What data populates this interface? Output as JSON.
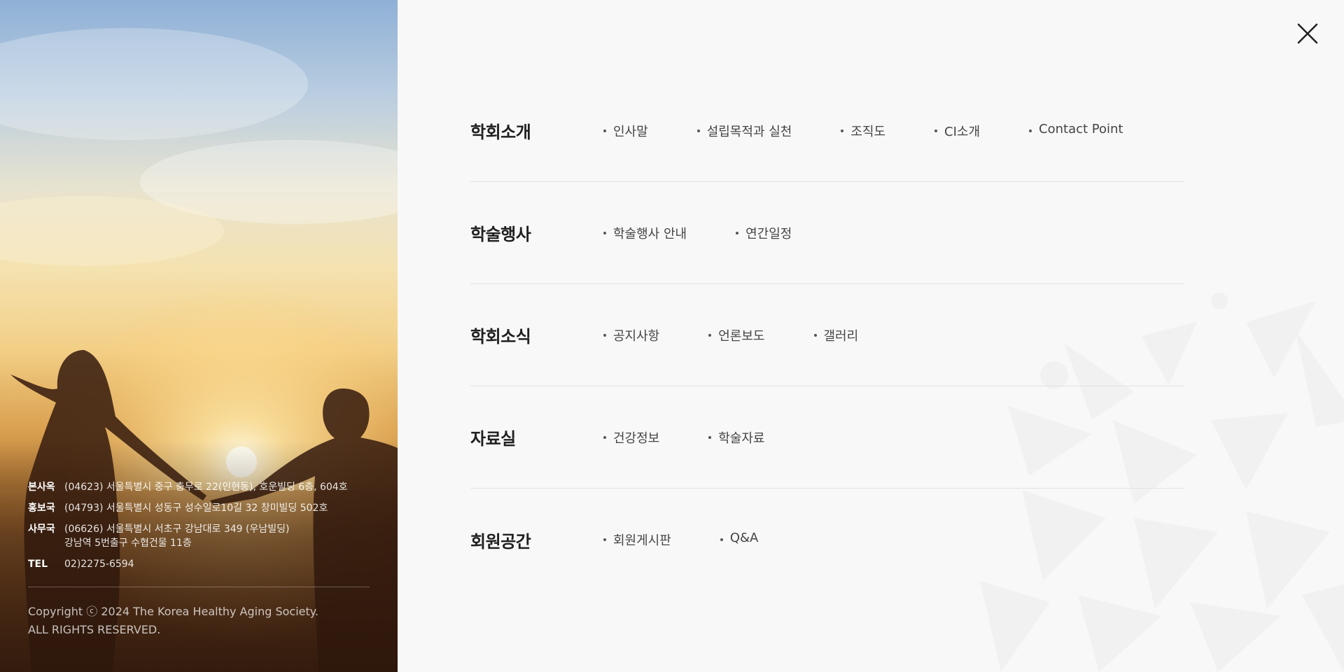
{
  "menu": [
    {
      "title": "학회소개",
      "items": [
        "인사말",
        "설립목적과 실천",
        "조직도",
        "CI소개",
        "Contact Point"
      ]
    },
    {
      "title": "학술행사",
      "items": [
        "학술행사 안내",
        "연간일정"
      ]
    },
    {
      "title": "학회소식",
      "items": [
        "공지사항",
        "언론보도",
        "갤러리"
      ]
    },
    {
      "title": "자료실",
      "items": [
        "건강정보",
        "학술자료"
      ]
    },
    {
      "title": "회원공간",
      "items": [
        "회원게시판",
        "Q&A"
      ]
    }
  ],
  "footer": {
    "addresses": [
      {
        "label": "본사옥",
        "lines": [
          "(04623) 서울특별시 중구 충무로 22(인현동), 호운빌딩 6층, 604호"
        ]
      },
      {
        "label": "홍보국",
        "lines": [
          "(04793) 서울특별시 성동구 성수일로10길 32 창미빌딩 502호"
        ]
      },
      {
        "label": "사무국",
        "lines": [
          "(06626) 서울특별시 서초구 강남대로 349 (우남빌딩)",
          "강남역 5번출구 수협건물 11층"
        ]
      },
      {
        "label": "TEL",
        "lines": [
          "02)2275-6594"
        ]
      }
    ],
    "copyright_line1": "Copyright ⓒ 2024 The Korea Healthy Aging Society.",
    "copyright_line2": "ALL RIGHTS RESERVED."
  },
  "icons": {
    "close": "close-icon"
  }
}
